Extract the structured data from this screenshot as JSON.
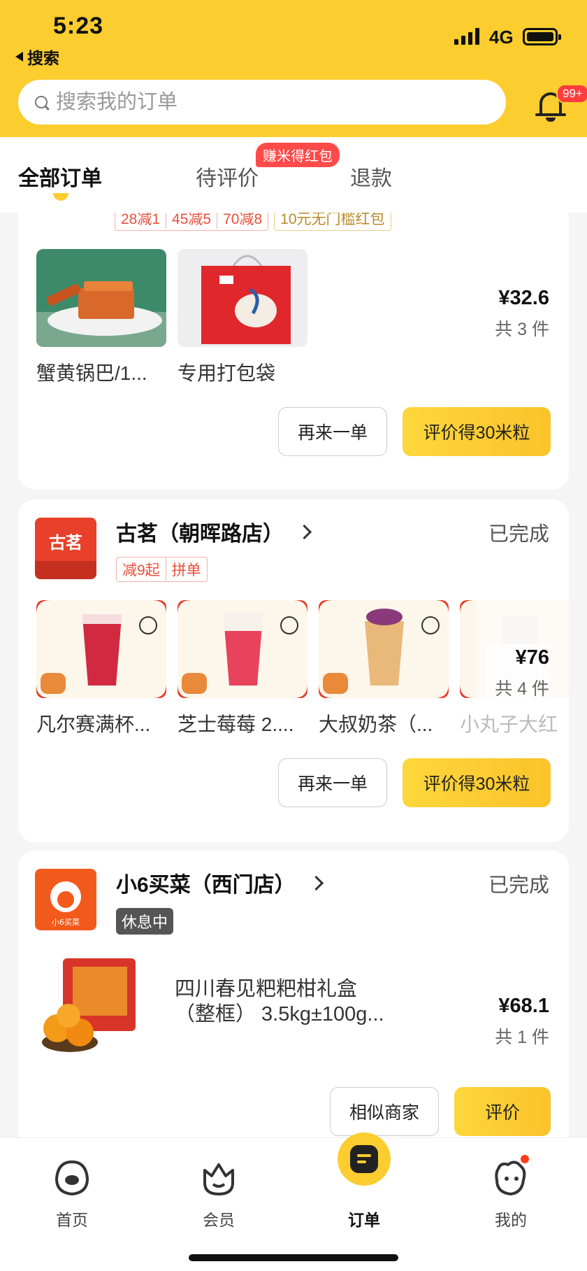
{
  "status_bar": {
    "time": "5:23",
    "back_label": "搜索",
    "network": "4G"
  },
  "search": {
    "placeholder": "搜索我的订单"
  },
  "notifications": {
    "badge": "99+"
  },
  "tabs": [
    {
      "label": "全部订单",
      "active": true
    },
    {
      "label": "待评价",
      "badge": "赚米得红包"
    },
    {
      "label": "退款"
    }
  ],
  "orders": [
    {
      "promo_tags": [
        "28减1",
        "45减5",
        "70减8"
      ],
      "promo_gold": "10元无门槛红包",
      "items": [
        {
          "label": "蟹黄锅巴/1...",
          "icon": "crispy-rice-photo"
        },
        {
          "label": "专用打包袋",
          "icon": "packing-bag-photo"
        }
      ],
      "price": "¥32.6",
      "count": "共 3 件",
      "buttons": [
        "再来一单",
        "评价得30米粒"
      ]
    },
    {
      "store": "古茗（朝晖路店）",
      "logo_text": "古茗",
      "status": "已完成",
      "tags": [
        "减9起",
        "拼单"
      ],
      "items": [
        {
          "label": "凡尔赛满杯...",
          "icon": "red-drink-photo"
        },
        {
          "label": "芝士莓莓 2....",
          "icon": "berry-drink-photo"
        },
        {
          "label": "大叔奶茶（...",
          "icon": "milk-tea-photo"
        },
        {
          "label": "小丸子大红",
          "icon": "drink-photo"
        }
      ],
      "price": "¥76",
      "count": "共 4 件",
      "buttons": [
        "再来一单",
        "评价得30米粒"
      ]
    },
    {
      "store": "小6买菜（西门店）",
      "logo_text": "小6买菜",
      "status": "已完成",
      "rest_tag": "休息中",
      "item_title_1": "四川春见粑粑柑礼盒",
      "item_title_2": "（整框） 3.5kg±100g...",
      "price": "¥68.1",
      "count": "共 1 件",
      "buttons": [
        "相似商家",
        "评价"
      ]
    }
  ],
  "bottom_nav": [
    {
      "label": "首页",
      "icon": "home-icon"
    },
    {
      "label": "会员",
      "icon": "member-icon"
    },
    {
      "label": "订单",
      "icon": "order-icon",
      "active": true
    },
    {
      "label": "我的",
      "icon": "profile-icon",
      "dot": true
    }
  ],
  "colors": {
    "brand_yellow": "#fbcd2f",
    "promo_red": "#e8503c",
    "badge_red": "#ff3d3d"
  }
}
